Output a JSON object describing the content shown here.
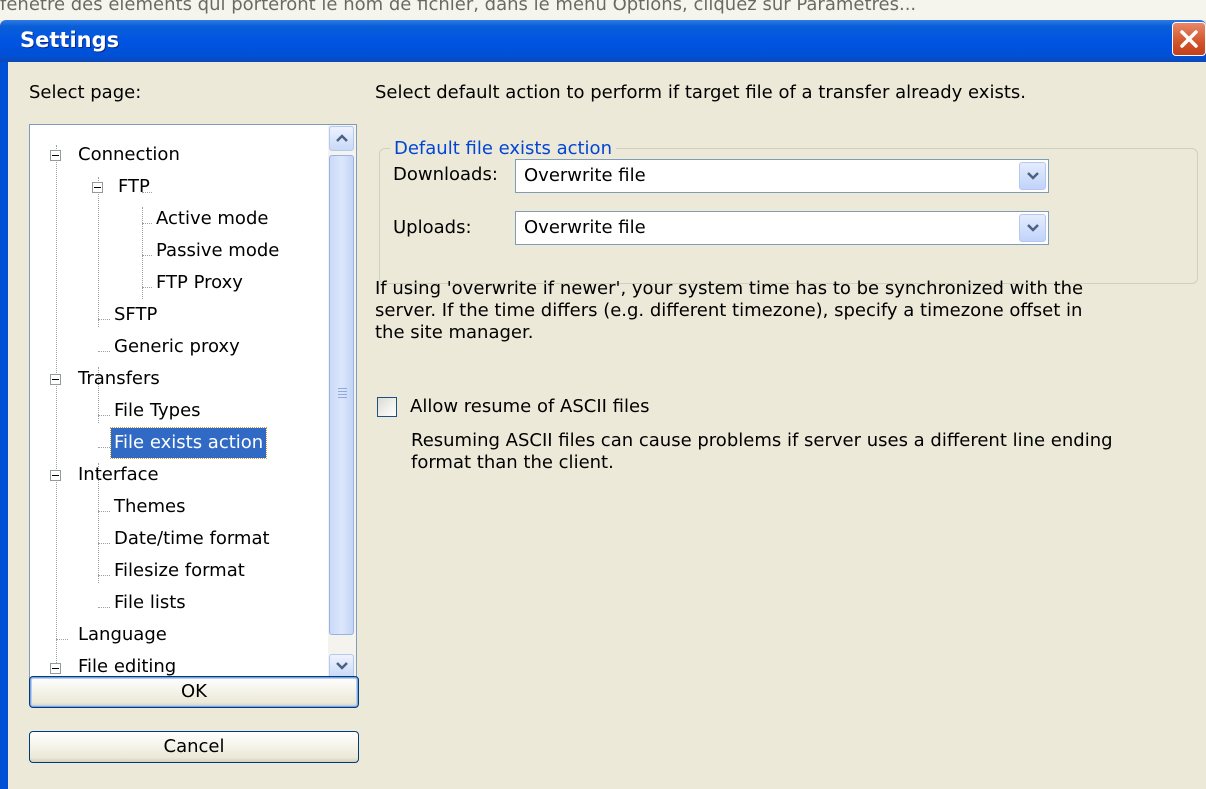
{
  "background_strip": "fenêtre des éléments qui porteront le nom de fichier, dans le menu Options, cliquez sur Paramètres...",
  "window": {
    "title": "Settings"
  },
  "left_panel": {
    "select_page_label": "Select page:",
    "tree": [
      {
        "label": "Connection"
      },
      {
        "label": "FTP"
      },
      {
        "label": "Active mode"
      },
      {
        "label": "Passive mode"
      },
      {
        "label": "FTP Proxy"
      },
      {
        "label": "SFTP"
      },
      {
        "label": "Generic proxy"
      },
      {
        "label": "Transfers"
      },
      {
        "label": "File Types"
      },
      {
        "label": "File exists action",
        "selected": true
      },
      {
        "label": "Interface"
      },
      {
        "label": "Themes"
      },
      {
        "label": "Date/time format"
      },
      {
        "label": "Filesize format"
      },
      {
        "label": "File lists"
      },
      {
        "label": "Language"
      },
      {
        "label": "File editing"
      }
    ],
    "ok_label": "OK",
    "cancel_label": "Cancel"
  },
  "right_panel": {
    "intro": "Select default action to perform if target file of a transfer already exists.",
    "group_title": "Default file exists action",
    "downloads_label": "Downloads:",
    "downloads_value": "Overwrite file",
    "uploads_label": "Uploads:",
    "uploads_value": "Overwrite file",
    "note_line1": "If using 'overwrite if newer', your system time has to be synchronized with the",
    "note_line2": "server. If the time differs (e.g. different timezone), specify a timezone offset in",
    "note_line3": "the site manager.",
    "checkbox_label": "Allow resume of ASCII files",
    "checkbox_checked": false,
    "help_line1": "Resuming ASCII files can cause problems if server uses a different line ending",
    "help_line2": "format than the client."
  }
}
